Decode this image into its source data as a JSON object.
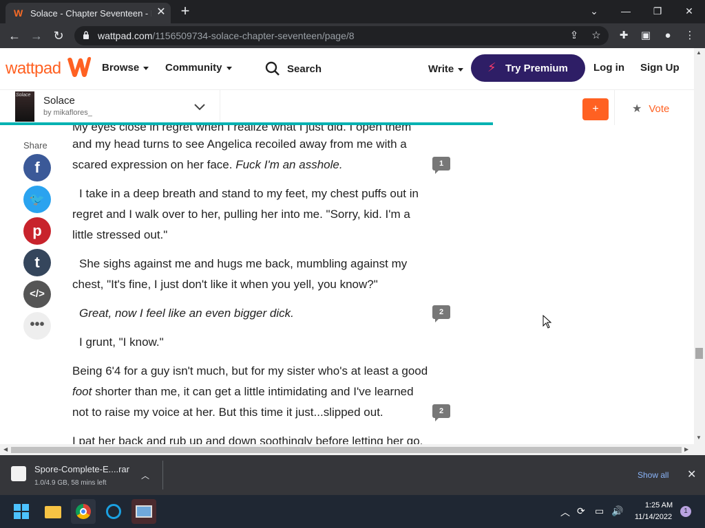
{
  "browser": {
    "tab_title": "Solace - Chapter Seventeen - Page",
    "url_host": "wattpad.com",
    "url_path": "/1156509734-solace-chapter-seventeen/page/8"
  },
  "header": {
    "logo": "wattpad",
    "browse": "Browse",
    "community": "Community",
    "search": "Search",
    "write": "Write",
    "premium": "Try Premium",
    "login": "Log in",
    "signup": "Sign Up"
  },
  "story": {
    "cover_text": "Solace",
    "title": "Solace",
    "author": "by mikaflores_",
    "add_label": "+",
    "vote_label": "Vote",
    "reading_progress": 0.71
  },
  "share": {
    "label": "Share"
  },
  "content": {
    "p0": "My eyes close in regret when I realize what I just did. I open them",
    "p1_a": "and my head turns to see Angelica recoiled away from me with a scared expression on her face. ",
    "p1_b": "Fuck I'm an asshole.",
    "c1": "1",
    "p2": "I take in a deep breath and stand to my feet, my chest puffs out in regret and I walk over to her, pulling her into me. \"Sorry, kid. I'm a little stressed out.\"",
    "p3": "She sighs against me and hugs me back, mumbling against my chest, \"It's fine, I just don't like it when you yell, you know?\"",
    "p4": "Great, now I feel like an even bigger dick.",
    "c2": "2",
    "p5": "I grunt, \"I know.\"",
    "p6_a": "Being 6'4 for a guy isn't much, but for my sister who's at least a good ",
    "p6_b": "foot",
    "p6_c": " shorter than me, it can get a little intimidating and I've learned not to raise my voice at her. But this time it just...slipped out.",
    "c3": "2",
    "p7": "I pat her back and rub up and down soothingly before letting her go."
  },
  "download": {
    "filename": "Spore-Complete-E....rar",
    "status": "1.0/4.9 GB, 58 mins left",
    "show_all": "Show all"
  },
  "taskbar": {
    "time": "1:25 AM",
    "date": "11/14/2022",
    "notifications": "1"
  }
}
